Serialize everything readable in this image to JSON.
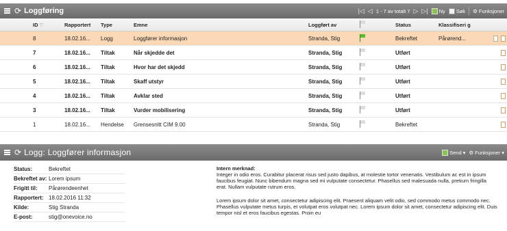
{
  "top_panel": {
    "title": "Loggføring",
    "pager_text": "1 - 7 av totalt 7",
    "new_label": "Ny",
    "search_label": "Søk",
    "functions_label": "Funksjoner"
  },
  "columns": {
    "id": "ID",
    "reportert": "Rapportert",
    "type": "Type",
    "emne": "Emne",
    "loggfort_av": "Loggført av",
    "status": "Status",
    "klassifisering": "Klassifiseri g"
  },
  "rows": [
    {
      "id": "8",
      "reportert": "18.02.16...",
      "type": "Logg",
      "emne": "Loggfører informasjon",
      "loggfort_av": "Stranda, Stig",
      "status": "Bekreftet",
      "klassifisering": "Pårørend..."
    },
    {
      "id": "7",
      "reportert": "18.02.16...",
      "type": "Tiltak",
      "emne": "Når skjedde det",
      "loggfort_av": "Stranda, Stig",
      "status": "Utført",
      "klassifisering": ""
    },
    {
      "id": "6",
      "reportert": "18.02.16...",
      "type": "Tiltak",
      "emne": "Hvor har det skjedd",
      "loggfort_av": "Stranda, Stig",
      "status": "Utført",
      "klassifisering": ""
    },
    {
      "id": "5",
      "reportert": "18.02.16...",
      "type": "Tiltak",
      "emne": "Skaff utstyr",
      "loggfort_av": "Stranda, Stig",
      "status": "Utført",
      "klassifisering": ""
    },
    {
      "id": "4",
      "reportert": "18.02.16...",
      "type": "Tiltak",
      "emne": "Avklar sted",
      "loggfort_av": "Stranda, Stig",
      "status": "Utført",
      "klassifisering": ""
    },
    {
      "id": "3",
      "reportert": "18.02.16...",
      "type": "Tiltak",
      "emne": "Vurder mobilisering",
      "loggfort_av": "Stranda, Stig",
      "status": "Utført",
      "klassifisering": ""
    },
    {
      "id": "1",
      "reportert": "18.02.16...",
      "type": "Hendelse",
      "emne": "Grensesnitt CIM 9.00",
      "loggfort_av": "Stranda, Stig",
      "status": "Bekreftet",
      "klassifisering": ""
    }
  ],
  "bottom_panel": {
    "title": "Logg: Loggfører informasjon",
    "send_label": "Send",
    "functions_label": "Funksjoner"
  },
  "details": {
    "fields": [
      {
        "label": "Status:",
        "value": "Bekreftet"
      },
      {
        "label": "Bekreftet av:",
        "value": "Lorem ipsum"
      },
      {
        "label": "Frigitt til:",
        "value": "Pårørendeenhet"
      },
      {
        "label": "Rapportert:",
        "value": "18.02.2016 11:32"
      },
      {
        "label": "Kilde:",
        "value": "Stig Stranda"
      },
      {
        "label": "E-post:",
        "value": "stig@onevoice.no"
      }
    ],
    "note_heading": "Intern merknad:",
    "note_text": "Integer in odio eros. Curabitur placerat risus sed justo dapibus, at molestie tortor venenatis. Vestibulum ac est in ipsum faucibus feugiat. Nunc bibendum magna sed mi vulputate consectetur. Phasellus sed malesuada nulla, pretium fringilla erat. Nullam vulputate rutrum eros.",
    "body_text": "Lorem ipsum dolor sit amet, consectetur adipiscing elit. Praesent aliquam velit odio, sed commodo metus commodo nec. Phasellus vulputate metus turpis, et volutpat eros volutpat nec. Lorem ipsum dolor sit amet, consectetur adipiscing elit. Duis tempor nisl et eros faucibus egestas. Proin eu"
  }
}
